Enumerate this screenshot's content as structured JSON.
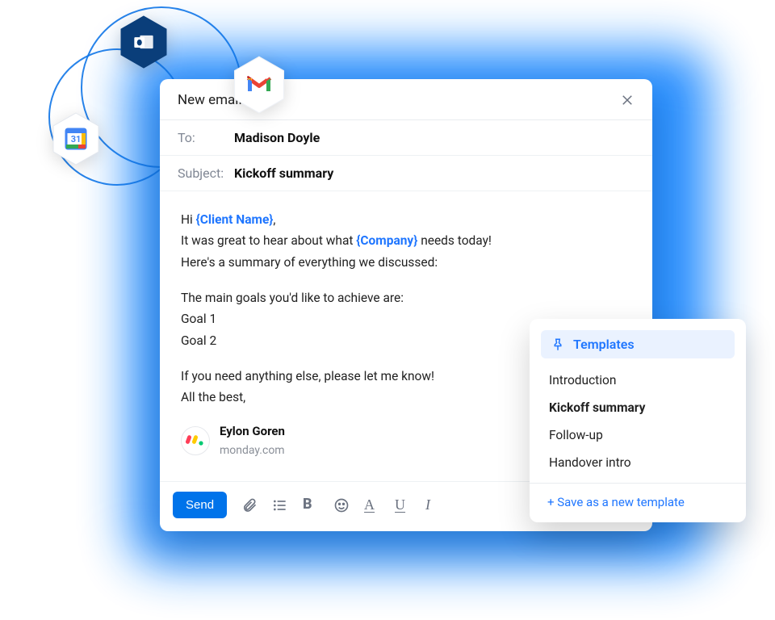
{
  "composer": {
    "title": "New email",
    "to_label": "To:",
    "to_value": "Madison Doyle",
    "subject_label": "Subject:",
    "subject_value": "Kickoff summary",
    "body": {
      "line1_pre": "Hi ",
      "ph_client": "{Client Name}",
      "line1_post": ",",
      "line2_pre": "It was great to hear about what ",
      "ph_company": "{Company}",
      "line2_post": " needs today!",
      "line3": "Here's a summary of everything we discussed:",
      "line4": "The main goals you'd like to achieve are:",
      "goal1": "Goal 1",
      "goal2": "Goal 2",
      "line5": "If you need anything else, please let me know!",
      "line6": "All the best,"
    },
    "signature": {
      "name": "Eylon Goren",
      "company": "monday.com"
    },
    "toolbar": {
      "send_label": "Send"
    }
  },
  "templates": {
    "title": "Templates",
    "items": [
      {
        "label": "Introduction",
        "active": false
      },
      {
        "label": "Kickoff summary",
        "active": true
      },
      {
        "label": "Follow-up",
        "active": false
      },
      {
        "label": "Handover intro",
        "active": false
      }
    ],
    "save_label": "+ Save as a new template"
  },
  "icons": {
    "outlook_color": "#0a3e7a",
    "gmail_colors": {
      "red": "#ea4335",
      "blue": "#4285f4",
      "green": "#34a853",
      "yellow": "#fbbc05"
    },
    "gcal_day": "31"
  }
}
